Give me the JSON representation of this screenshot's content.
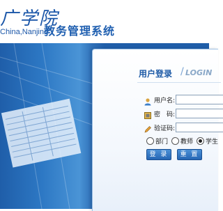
{
  "header": {
    "logo_cn": "广学院",
    "logo_en": "China,Nanjing",
    "system_title": "教务管理系统"
  },
  "login": {
    "title_cn": "用户登录",
    "title_sep": "/",
    "title_en": "LOGIN",
    "username_label": "用户名:",
    "password_label": "密　码:",
    "captcha_label": "验证码:",
    "username_value": "",
    "password_value": "",
    "captcha_value": "",
    "roles": [
      {
        "label": "部门",
        "selected": false
      },
      {
        "label": "教师",
        "selected": false
      },
      {
        "label": "学生",
        "selected": true
      }
    ],
    "login_button": "登 录",
    "reset_button": "重 置"
  },
  "colors": {
    "brand_blue": "#1f5ea9",
    "title_blue": "#1d5aa6",
    "panel_border": "#9cc0e6"
  },
  "icons": {
    "username": "user-icon",
    "password": "lock-icon",
    "captcha": "pencil-icon"
  }
}
